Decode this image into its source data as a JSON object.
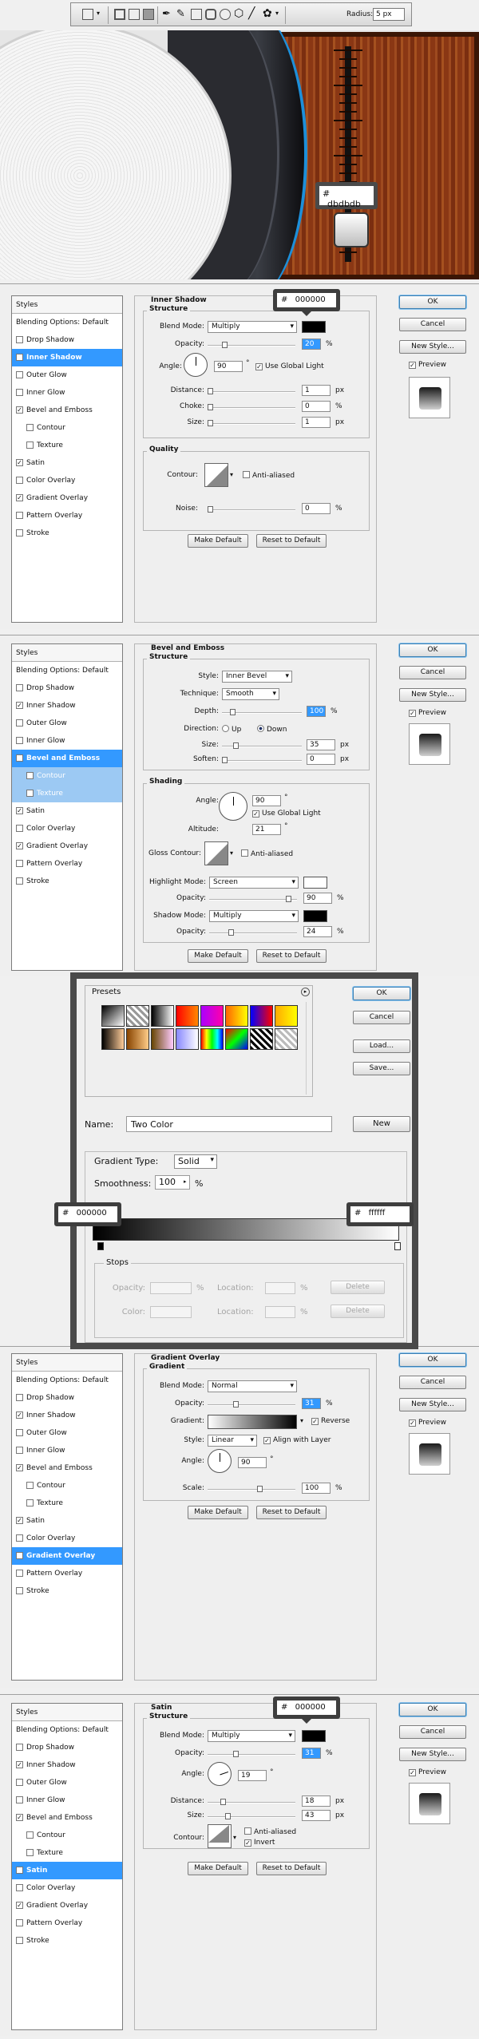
{
  "toolbar": {
    "radius_label": "Radius:",
    "radius_value": "5 px",
    "icons": [
      "rect-select-icon",
      "dropdown-arrow-icon",
      "path-mode-icon",
      "fill-pixels-icon",
      "pen-icon",
      "freeform-pen-icon",
      "rectangle-icon",
      "rounded-rect-icon",
      "ellipse-icon",
      "polygon-icon",
      "line-icon",
      "custom-shape-icon",
      "shape-dropdown-icon"
    ]
  },
  "hero": {
    "tooltip_hash": "#",
    "tooltip_value": "dbdbdb",
    "accent_color": "#1d8fd9",
    "wood_color": "#8a3714"
  },
  "styles_list": {
    "header": "Styles",
    "items": [
      {
        "label": "Blending Options: Default",
        "checkbox": false
      },
      {
        "label": "Drop Shadow",
        "checkbox": true
      },
      {
        "label": "Inner Shadow",
        "checkbox": true
      },
      {
        "label": "Outer Glow",
        "checkbox": true
      },
      {
        "label": "Inner Glow",
        "checkbox": true
      },
      {
        "label": "Bevel and Emboss",
        "checkbox": true
      },
      {
        "label": "Contour",
        "checkbox": true,
        "sub": true
      },
      {
        "label": "Texture",
        "checkbox": true,
        "sub": true
      },
      {
        "label": "Satin",
        "checkbox": true
      },
      {
        "label": "Color Overlay",
        "checkbox": true
      },
      {
        "label": "Gradient Overlay",
        "checkbox": true
      },
      {
        "label": "Pattern Overlay",
        "checkbox": true
      },
      {
        "label": "Stroke",
        "checkbox": true
      }
    ]
  },
  "buttons": {
    "ok": "OK",
    "cancel": "Cancel",
    "new_style": "New Style...",
    "preview": "Preview",
    "make_default": "Make Default",
    "reset_default": "Reset to Default"
  },
  "inner_shadow": {
    "title": "Inner Shadow",
    "structure": "Structure",
    "blend_mode_label": "Blend Mode:",
    "blend_mode": "Multiply",
    "opacity_label": "Opacity:",
    "opacity": "20",
    "angle_label": "Angle:",
    "angle": "90",
    "global_light": "Use Global Light",
    "distance_label": "Distance:",
    "distance": "1",
    "choke_label": "Choke:",
    "choke": "0",
    "size_label": "Size:",
    "size": "1",
    "quality": "Quality",
    "contour_label": "Contour:",
    "anti_aliased": "Anti-aliased",
    "noise_label": "Noise:",
    "noise": "0",
    "tip_hash": "#",
    "tip_value": "000000",
    "checked": [
      0,
      0,
      1,
      0,
      0,
      1,
      0,
      0,
      1,
      0,
      1,
      0,
      0
    ]
  },
  "bevel": {
    "title": "Bevel and Emboss",
    "structure": "Structure",
    "style_label": "Style:",
    "style": "Inner Bevel",
    "technique_label": "Technique:",
    "technique": "Smooth",
    "depth_label": "Depth:",
    "depth": "100",
    "direction_label": "Direction:",
    "dir_up": "Up",
    "dir_down": "Down",
    "size_label": "Size:",
    "size": "35",
    "soften_label": "Soften:",
    "soften": "0",
    "shading": "Shading",
    "angle_label": "Angle:",
    "angle": "90",
    "global_light": "Use Global Light",
    "altitude_label": "Altitude:",
    "altitude": "21",
    "gloss_label": "Gloss Contour:",
    "anti_aliased": "Anti-aliased",
    "highlight_label": "Highlight Mode:",
    "highlight_mode": "Screen",
    "opacity_label": "Opacity:",
    "highlight_opacity": "90",
    "shadow_label": "Shadow Mode:",
    "shadow_mode": "Multiply",
    "shadow_opacity": "24",
    "checked": [
      0,
      0,
      1,
      0,
      0,
      1,
      0,
      0,
      1,
      0,
      1,
      0,
      0
    ]
  },
  "gradient_editor": {
    "presets": "Presets",
    "ok": "OK",
    "cancel": "Cancel",
    "load": "Load...",
    "save": "Save...",
    "name_label": "Name:",
    "name": "Two Color",
    "new": "New",
    "type_label": "Gradient Type:",
    "type": "Solid",
    "smooth_label": "Smoothness:",
    "smoothness": "100",
    "pct": "%",
    "left_hash": "#",
    "left_value": "000000",
    "right_hash": "#",
    "right_value": "ffffff",
    "stops": "Stops",
    "opacity_label": "Opacity:",
    "location_label": "Location:",
    "color_label": "Color:",
    "delete": "Delete",
    "preset_colors": [
      "linear-gradient(135deg,#000,#fff)",
      "repeating-linear-gradient(45deg,#999 0 3px,#fff 3px 6px)",
      "linear-gradient(90deg,#000,#fff)",
      "linear-gradient(90deg,#f00,#f80)",
      "linear-gradient(90deg,#a0f,#f0a)",
      "linear-gradient(90deg,#f60,#ff0)",
      "linear-gradient(90deg,#00f,#f00)",
      "linear-gradient(90deg,#fa0,#ff0)",
      "linear-gradient(90deg,#000,#fc9)",
      "linear-gradient(90deg,#840,#fc8)",
      "linear-gradient(90deg,#640,#fcf)",
      "linear-gradient(90deg,#88f,#fff)",
      "linear-gradient(90deg,#f00,#ff0,#0f0,#0ff,#00f)",
      "linear-gradient(135deg,#f00,#0f0,#00f)",
      "repeating-linear-gradient(45deg,#000 0 3px,#fff 3px 6px)",
      "repeating-linear-gradient(45deg,#bbb 0 3px,#fff 3px 6px)"
    ]
  },
  "gradient_overlay": {
    "title": "Gradient Overlay",
    "section": "Gradient",
    "blend_mode_label": "Blend Mode:",
    "blend_mode": "Normal",
    "opacity_label": "Opacity:",
    "opacity": "31",
    "gradient_label": "Gradient:",
    "reverse": "Reverse",
    "style_label": "Style:",
    "style": "Linear",
    "align": "Align with Layer",
    "angle_label": "Angle:",
    "angle": "90",
    "scale_label": "Scale:",
    "scale": "100",
    "checked": [
      0,
      0,
      1,
      0,
      0,
      1,
      0,
      0,
      1,
      0,
      1,
      0,
      0
    ]
  },
  "satin": {
    "title": "Satin",
    "structure": "Structure",
    "blend_mode_label": "Blend Mode:",
    "blend_mode": "Multiply",
    "opacity_label": "Opacity:",
    "opacity": "31",
    "angle_label": "Angle:",
    "angle": "19",
    "distance_label": "Distance:",
    "distance": "18",
    "size_label": "Size:",
    "size": "43",
    "contour_label": "Contour:",
    "anti_aliased": "Anti-aliased",
    "invert": "Invert",
    "tip_hash": "#",
    "tip_value": "000000",
    "checked": [
      0,
      0,
      1,
      0,
      0,
      1,
      0,
      0,
      1,
      0,
      1,
      0,
      0
    ]
  },
  "units": {
    "pct": "%",
    "px": "px",
    "deg": "°"
  }
}
